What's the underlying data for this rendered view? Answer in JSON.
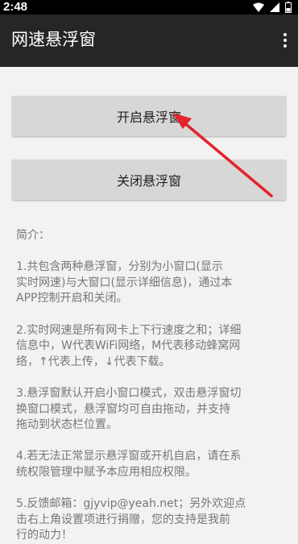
{
  "status_bar": {
    "time": "2:48",
    "icons": [
      "wifi-icon",
      "cellular-signal-icon",
      "battery-icon"
    ]
  },
  "app_bar": {
    "title": "网速悬浮窗",
    "menu_icon": "more-vert-icon",
    "background_color": "#262626"
  },
  "buttons": {
    "open_label": "开启悬浮窗",
    "close_label": "关闭悬浮窗"
  },
  "intro": {
    "heading": "简介：",
    "items": [
      {
        "lines": [
          "1.共包含两种悬浮窗，分别为小窗口(显示",
          "实时网速)与大窗口(显示详细信息)，通过本",
          "APP控制开启和关闭。"
        ]
      },
      {
        "lines": [
          "2.实时网速是所有网卡上下行速度之和；详细",
          "信息中，W代表WiFi网络，M代表移动蜂窝网",
          "络，↑代表上传，↓代表下载。"
        ]
      },
      {
        "lines": [
          "3.悬浮窗默认开启小窗口模式，双击悬浮窗切",
          "换窗口模式，悬浮窗均可自由拖动，并支持",
          "拖动到状态栏位置。"
        ]
      },
      {
        "lines": [
          "4.若无法正常显示悬浮窗或开机自启，请在系",
          "统权限管理中赋予本应用相应权限。"
        ]
      },
      {
        "lines": [
          "5.反馈邮箱：gjyvip@yeah.net；另外欢迎点",
          "击右上角设置项进行捐赠，您的支持是我前",
          "行的动力！"
        ]
      }
    ]
  },
  "annotation": {
    "arrow_color": "#e3242b"
  }
}
